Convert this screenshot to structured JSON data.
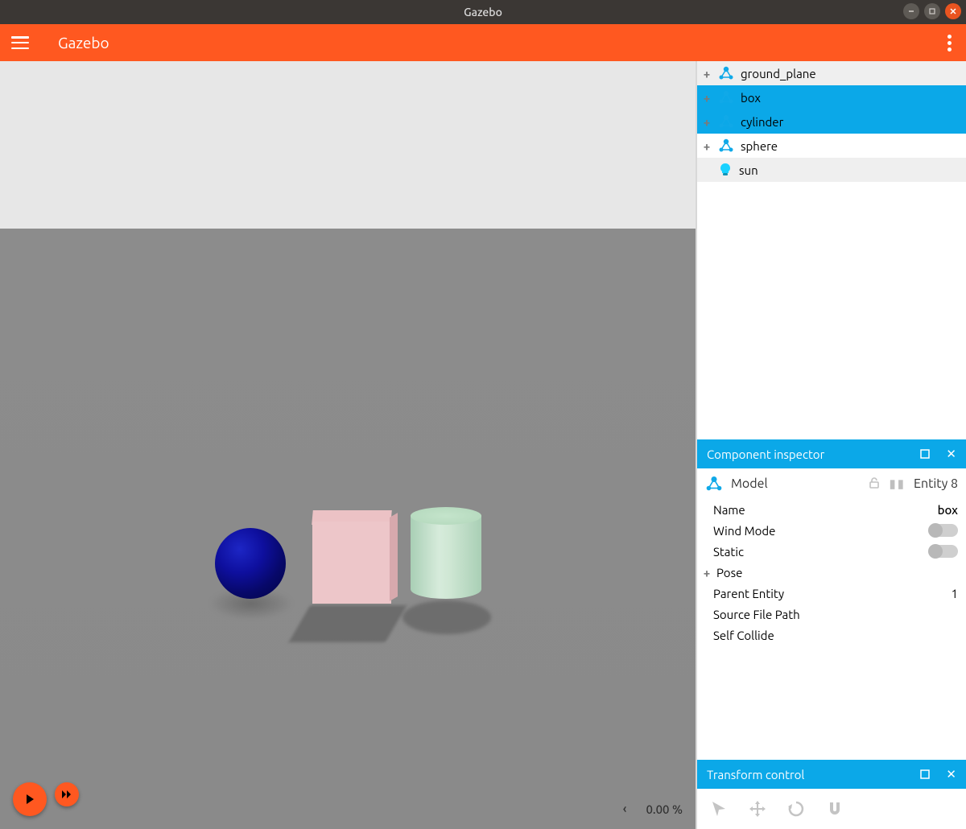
{
  "window": {
    "title": "Gazebo"
  },
  "header": {
    "app_title": "Gazebo"
  },
  "tree": {
    "items": [
      {
        "label": "ground_plane",
        "type": "model",
        "expandable": true,
        "selected": false
      },
      {
        "label": "box",
        "type": "model",
        "expandable": true,
        "selected": true
      },
      {
        "label": "cylinder",
        "type": "model",
        "expandable": true,
        "selected": true
      },
      {
        "label": "sphere",
        "type": "model",
        "expandable": true,
        "selected": false
      },
      {
        "label": "sun",
        "type": "light",
        "expandable": false,
        "selected": false
      }
    ]
  },
  "inspector": {
    "panel_title": "Component inspector",
    "type_label": "Model",
    "entity_label": "Entity 8",
    "rows": {
      "name_k": "Name",
      "name_v": "box",
      "wind_k": "Wind Mode",
      "static_k": "Static",
      "pose_k": "Pose",
      "parent_k": "Parent Entity",
      "parent_v": "1",
      "source_k": "Source File Path",
      "self_k": "Self Collide"
    }
  },
  "transform": {
    "panel_title": "Transform control"
  },
  "status": {
    "percent": "0.00 %"
  }
}
